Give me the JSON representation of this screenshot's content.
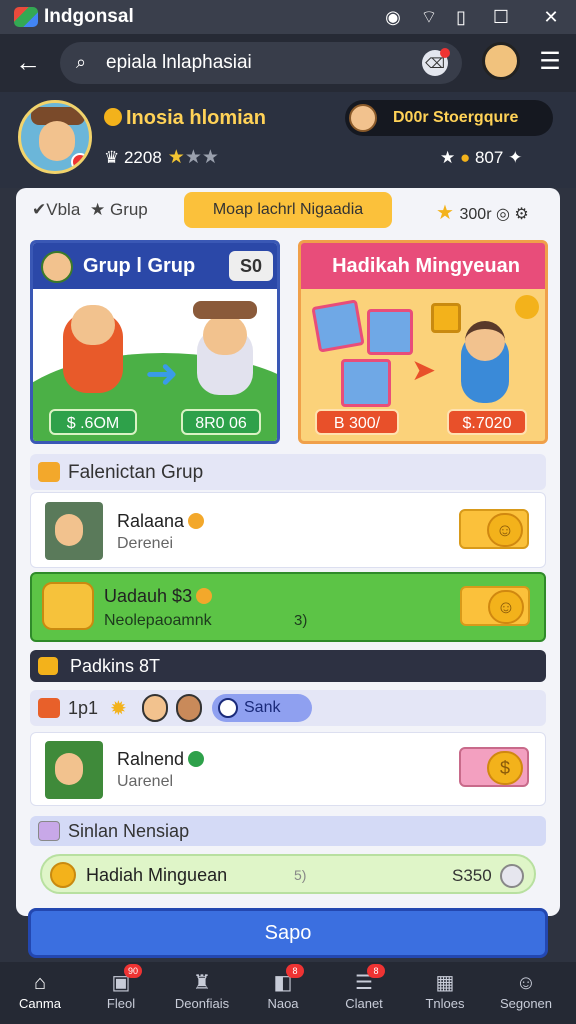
{
  "statusbar": {
    "title": "Indgonsal"
  },
  "search": {
    "value": "epiala lnlaphasiai"
  },
  "profile": {
    "name": "Inosia hlomian",
    "points": "2208",
    "badge": "D00r Stoergqure",
    "right_value": "807"
  },
  "tabs": {
    "left": "Vbla",
    "group": "Grup",
    "active": "Moap lachrl Nigaadia",
    "right_value": "300r"
  },
  "card_group": {
    "title": "Grup l Grup",
    "pill": "S0",
    "left_amount": "$ .6OM",
    "right_amount": "8R0 06"
  },
  "card_weekly": {
    "title": "Hadikah Mingyeuan",
    "left_amount": "B 300/",
    "right_amount": "$.7020"
  },
  "section_group": {
    "title": "Falenictan Grup"
  },
  "row1": {
    "name": "Ralaana",
    "sub": "Derenei"
  },
  "weekly_row": {
    "name": "Uadauh $3",
    "sub": "Neolepaoamnk",
    "mid": "3)"
  },
  "packs": {
    "title": "Padkins 8T"
  },
  "filter": {
    "label": "1p1",
    "chip": "Sank"
  },
  "row2": {
    "name": "Ralnend",
    "sub": "Uarenel",
    "coin_glyph": "$"
  },
  "save_section": {
    "title": "Sinlan Nensiap"
  },
  "weekly_bar": {
    "label": "Hadiah Minguean",
    "mid": "5)",
    "value": "S350"
  },
  "save_button": {
    "label": "Sapo"
  },
  "nav": [
    {
      "label": "Canma",
      "icon": "home-icon",
      "glyph": "⌂",
      "badge": ""
    },
    {
      "label": "Fleol",
      "icon": "calendar-icon",
      "glyph": "▣",
      "badge": "90"
    },
    {
      "label": "Deonfiais",
      "icon": "friends-icon",
      "glyph": "♜",
      "badge": ""
    },
    {
      "label": "Naoa",
      "icon": "bag-icon",
      "glyph": "◧",
      "badge": "8"
    },
    {
      "label": "Clanet",
      "icon": "list-icon",
      "glyph": "☰",
      "badge": "8"
    },
    {
      "label": "Tnloes",
      "icon": "box-icon",
      "glyph": "▦",
      "badge": ""
    },
    {
      "label": "Segonen",
      "icon": "profile-icon",
      "glyph": "☺",
      "badge": ""
    }
  ],
  "colors": {
    "accent": "#fbc13b",
    "primary": "#3b6fe0",
    "green": "#5cc446"
  }
}
